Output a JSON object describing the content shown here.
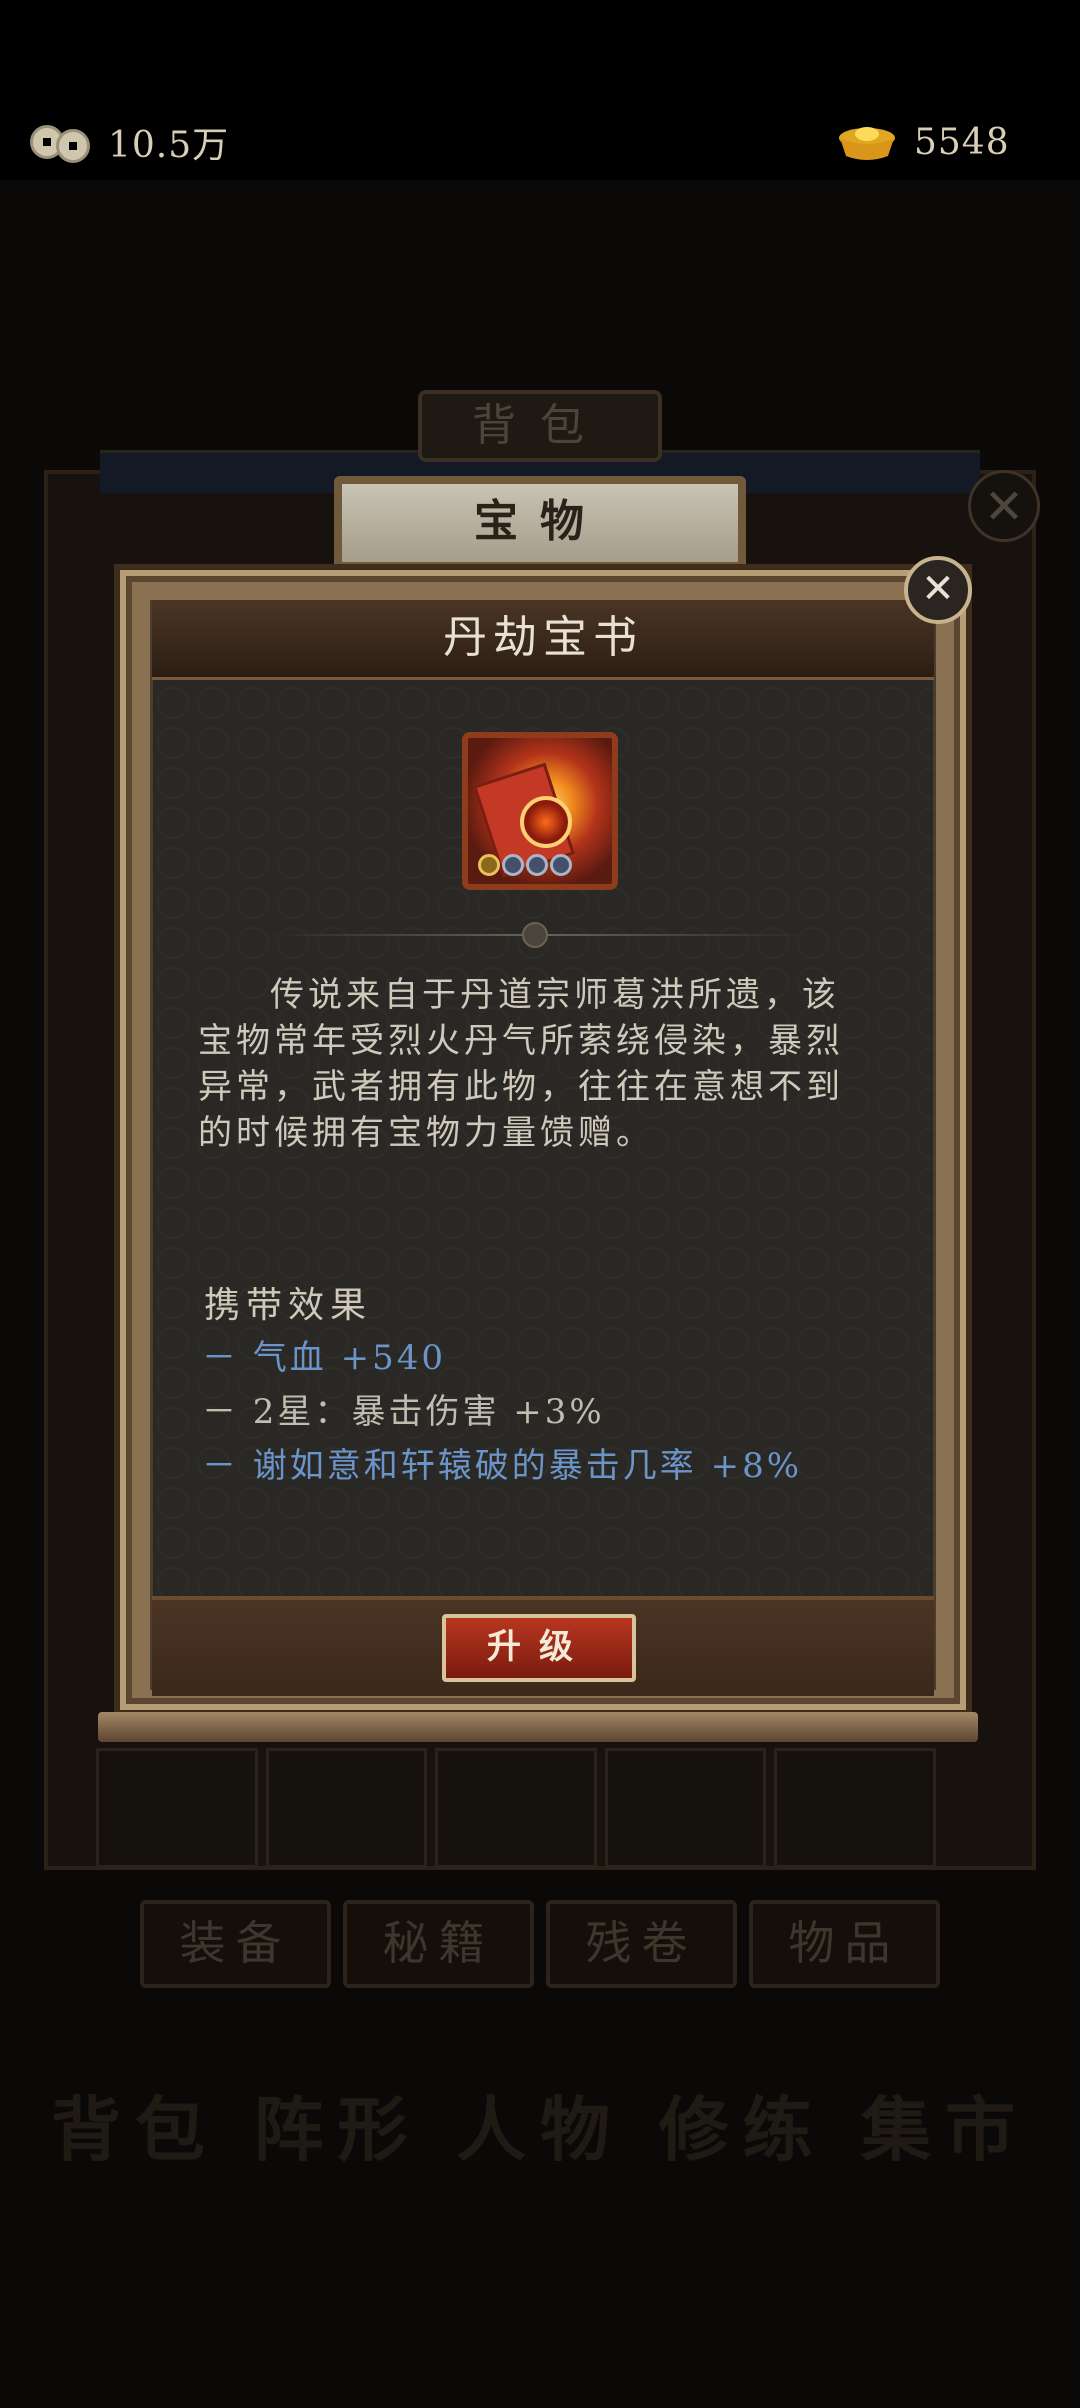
{
  "resources": {
    "coins": "10.5万",
    "gold": "5548"
  },
  "background": {
    "bag_tab": "背包",
    "categories": [
      "装备",
      "秘籍",
      "残卷",
      "物品"
    ],
    "nav": [
      "背包",
      "阵形",
      "人物",
      "修练",
      "集市"
    ]
  },
  "modal": {
    "category": "宝物",
    "item_name": "丹劫宝书",
    "description": "传说来自于丹道宗师葛洪所遗，该宝物常年受烈火丹气所萦绕侵染，暴烈异常，武者拥有此物，往往在意想不到的时候拥有宝物力量馈赠。",
    "effects_title": "携带效果",
    "effects": [
      "－ 气血 +540",
      "－ 2星：暴击伤害 +3%",
      "－ 谢如意和轩辕破的暴击几率 +8%"
    ],
    "upgrade_label": "升级"
  },
  "colors": {
    "effect_active": "#6b94c9",
    "effect_inactive": "#c2bcb0",
    "button_red": "#b8361f"
  },
  "icons": [
    "coin-icon",
    "gold-ingot-icon",
    "close-icon",
    "treasure-book-icon"
  ]
}
